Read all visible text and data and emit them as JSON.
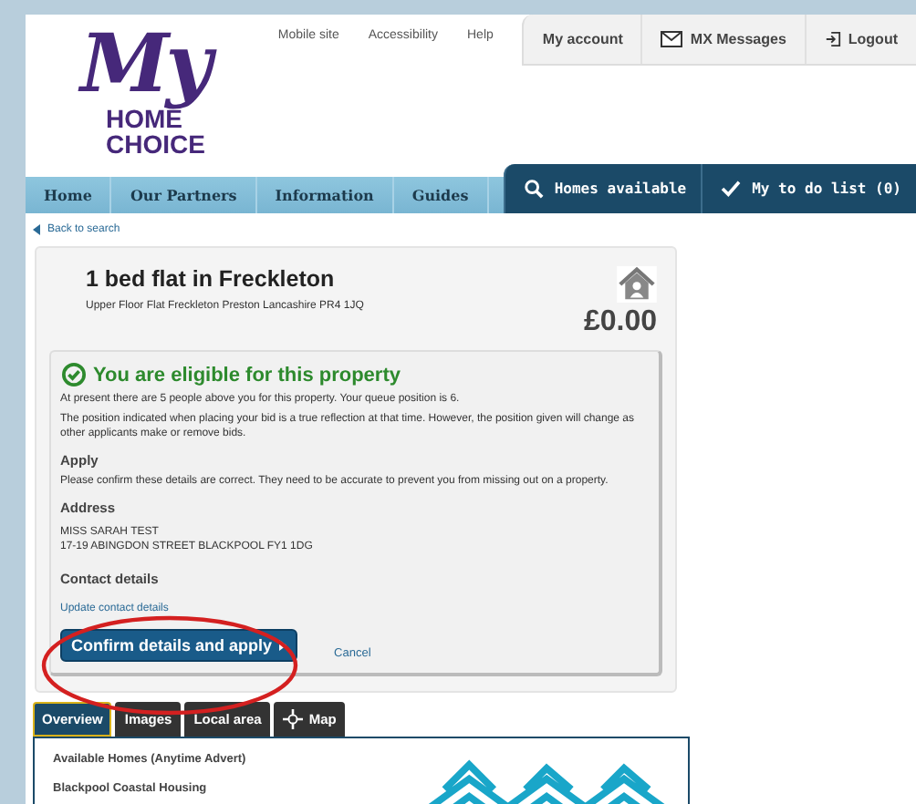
{
  "logo": {
    "script": "My",
    "line1": "HOME",
    "line2": "CHOICE"
  },
  "top_links": [
    "Mobile site",
    "Accessibility",
    "Help"
  ],
  "account_tabs": [
    {
      "label": "My account"
    },
    {
      "label": "MX Messages"
    },
    {
      "label": "Logout"
    }
  ],
  "nav": [
    {
      "label": "Home"
    },
    {
      "label": "Our Partners"
    },
    {
      "label": "Information"
    },
    {
      "label": "Guides"
    }
  ],
  "nav_actions": [
    {
      "label": "Homes available"
    },
    {
      "label": "My to do list (0)"
    }
  ],
  "back_link": "Back to search",
  "property": {
    "title": "1 bed flat in Freckleton",
    "address": "Upper Floor Flat Freckleton Preston Lancashire PR4 1JQ",
    "price": "£0.00"
  },
  "eligibility": {
    "heading": "You are eligible for this property",
    "paragraphs": [
      "At present there are 5 people above you for this property. Your queue position is 6.",
      "The position indicated when placing your bid is a true reflection at that time. However, the position given will change as other applicants make or remove bids."
    ],
    "apply_heading": "Apply",
    "apply_text": "Please confirm these details are correct. They need to be accurate to prevent you from missing out on a property.",
    "address_heading": "Address",
    "address_lines": [
      "MISS SARAH TEST",
      "17-19 ABINGDON STREET BLACKPOOL FY1 1DG"
    ],
    "contact_heading": "Contact details",
    "contact_link": "Update contact details",
    "confirm_button": "Confirm details and apply",
    "cancel_link": "Cancel"
  },
  "detail_tabs": [
    {
      "label": "Overview",
      "selected": true
    },
    {
      "label": "Images",
      "selected": false
    },
    {
      "label": "Local area",
      "selected": false
    },
    {
      "label": "Map",
      "selected": false
    }
  ],
  "overview": [
    "Available Homes (Anytime Advert)",
    "Blackpool Coastal Housing"
  ]
}
